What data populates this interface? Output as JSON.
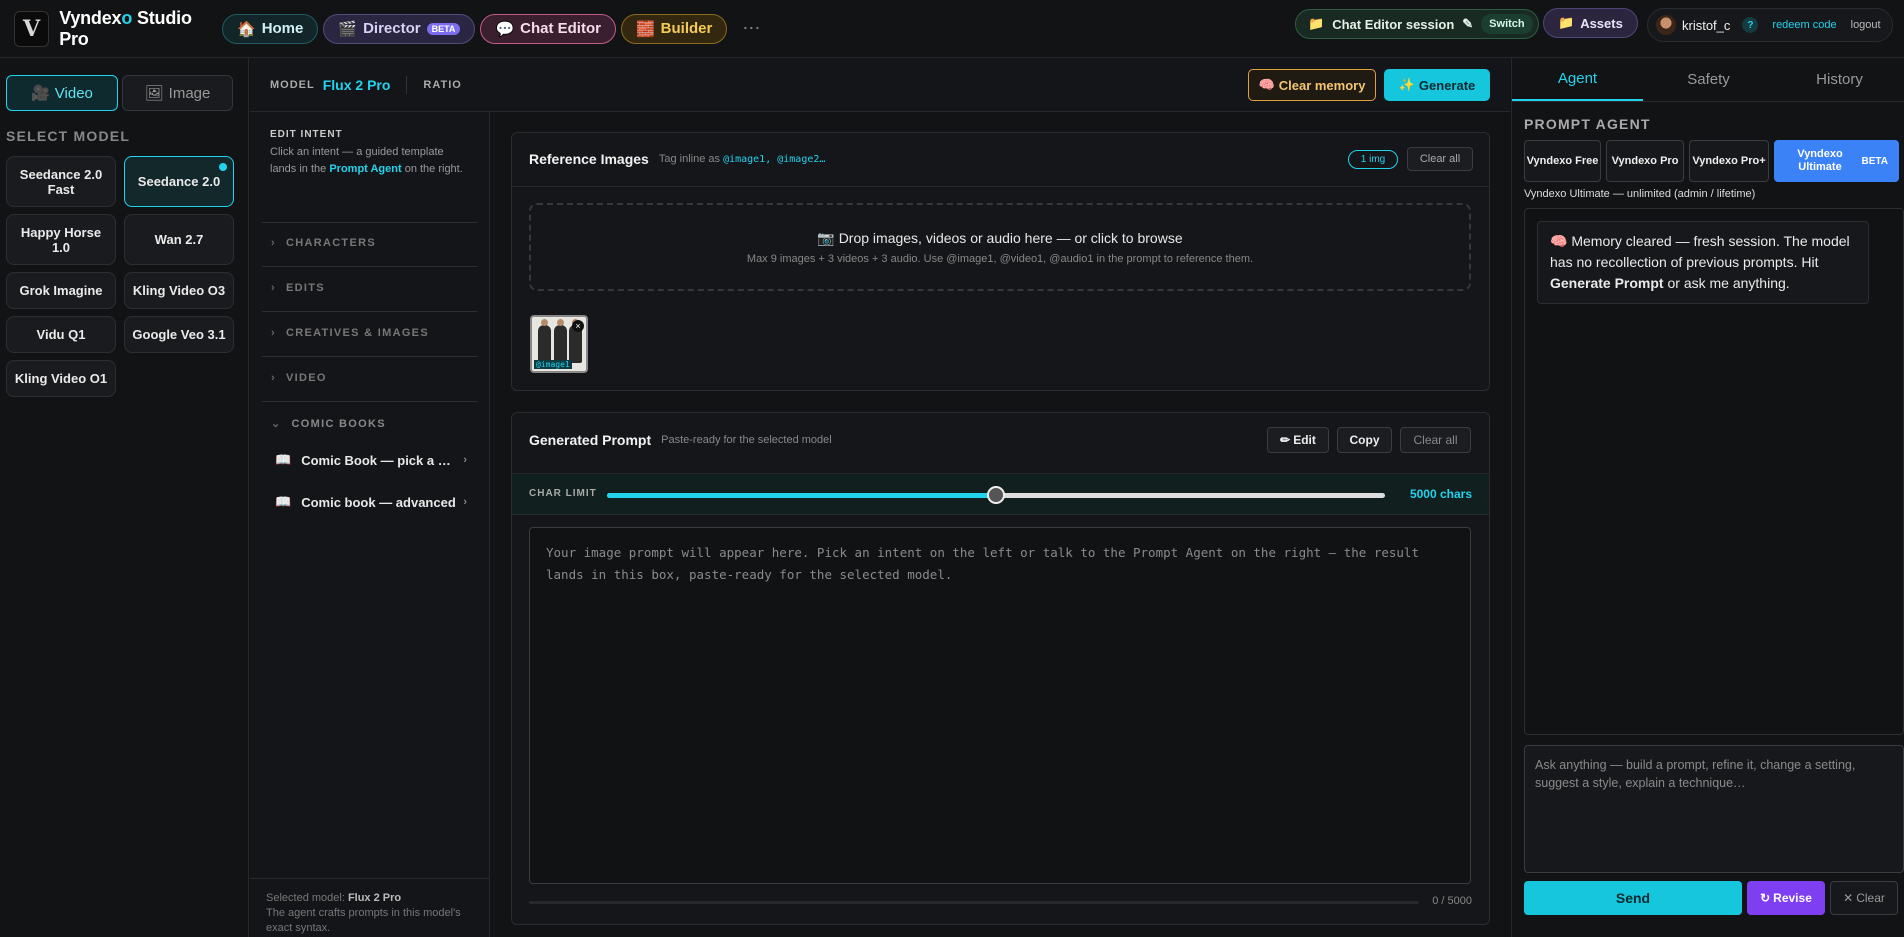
{
  "brand": {
    "name_part1": "Vyndex",
    "name_accent": "o",
    "name_part2": " Studio Pro",
    "logo_letter": "V"
  },
  "nav": {
    "home": "Home",
    "director": "Director",
    "director_badge": "BETA",
    "chat_editor": "Chat Editor",
    "builder": "Builder",
    "more": "⋯"
  },
  "session": {
    "label": "Chat Editor session",
    "switch": "Switch"
  },
  "assets": "Assets",
  "user": {
    "name": "kristof_c",
    "help": "?",
    "redeem": "redeem code",
    "logout": "logout"
  },
  "left": {
    "video_label": "Video",
    "image_label": "Image",
    "select_model_title": "SELECT MODEL",
    "models": [
      {
        "name": "Seedance 2.0 Fast"
      },
      {
        "name": "Seedance 2.0",
        "active": true
      },
      {
        "name": "Happy Horse 1.0"
      },
      {
        "name": "Wan 2.7"
      },
      {
        "name": "Grok Imagine"
      },
      {
        "name": "Kling Video O3"
      },
      {
        "name": "Vidu Q1"
      },
      {
        "name": "Google Veo 3.1"
      },
      {
        "name": "Kling Video O1"
      }
    ]
  },
  "toolbar": {
    "model_label": "MODEL",
    "model_value": "Flux 2 Pro",
    "ratio_label": "RATIO",
    "clear_memory": "Clear memory",
    "generate": "Generate"
  },
  "intent": {
    "title": "EDIT INTENT",
    "desc_before": "Click an intent — a guided template lands in the ",
    "desc_link": "Prompt Agent",
    "desc_after": " on the right.",
    "sections": [
      "CHARACTERS",
      "EDITS",
      "CREATIVES & IMAGES",
      "VIDEO",
      "COMIC BOOKS"
    ],
    "comic_items": [
      "Comic Book — pick a style",
      "Comic book — advanced"
    ],
    "footer_label": "Selected model: ",
    "footer_model": "Flux 2 Pro",
    "footer_desc": "The agent crafts prompts in this model's exact syntax."
  },
  "reference": {
    "title": "Reference Images",
    "tag_text": "Tag inline as ",
    "tag_codes": "@image1, @image2…",
    "count": "1 img",
    "clear_all": "Clear all",
    "drop_title": "Drop images, videos or audio here — or click to browse",
    "drop_sub": "Max 9 images + 3 videos + 3 audio. Use @image1, @video1, @audio1 in the prompt to reference them.",
    "thumb_tag": "@image1",
    "thumb_remove": "×"
  },
  "generated": {
    "title": "Generated Prompt",
    "subtitle": "Paste-ready for the selected model",
    "edit": "Edit",
    "copy": "Copy",
    "clear_all": "Clear all",
    "char_limit_label": "CHAR LIMIT",
    "char_limit_value": "5000 chars",
    "char_limit_fraction": 0.5,
    "placeholder": "Your image prompt will appear here. Pick an intent on the left or talk to the Prompt Agent on the right — the result lands in this box, paste-ready for the selected model.",
    "count": "0 / 5000"
  },
  "right": {
    "tabs": [
      "Agent",
      "Safety",
      "History"
    ],
    "agent_title": "PROMPT AGENT",
    "tiers": [
      "Vyndexo Free",
      "Vyndexo Pro",
      "Vyndexo Pro+",
      "Vyndexo Ultimate"
    ],
    "tier_badge": "BETA",
    "tier_sub": "Vyndexo Ultimate — unlimited (admin / lifetime)",
    "message_p1": "Memory cleared — fresh session. The model has no recollection of previous prompts. Hit ",
    "message_bold": "Generate Prompt",
    "message_p2": " or ask me anything.",
    "ask_placeholder": "Ask anything — build a prompt, refine it, change a setting, suggest a style, explain a technique…",
    "send": "Send",
    "revise": "Revise",
    "clear": "Clear"
  },
  "colors": {
    "accent": "#22d3ee",
    "ultimate": "#3b82f6",
    "revise": "#7e3ef2",
    "clear_memory": "#e0a13a"
  }
}
